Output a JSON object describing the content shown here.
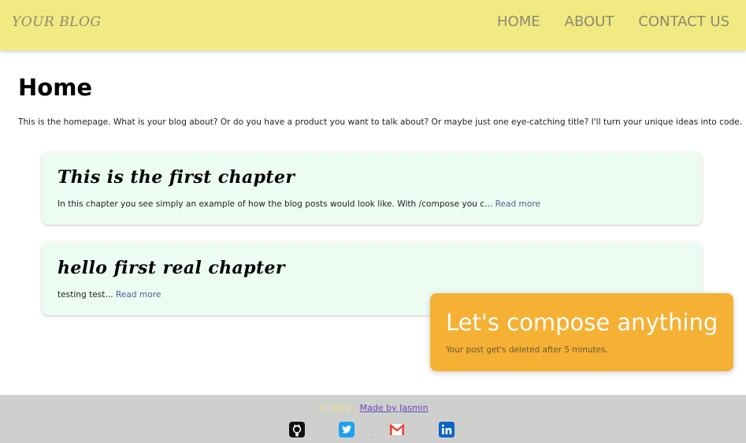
{
  "navbar": {
    "brand": "YOUR BLOG",
    "links": [
      "HOME",
      "ABOUT",
      "CONTACT US"
    ],
    "background": "#f1ea82"
  },
  "page": {
    "title": "Home",
    "intro": "This is the homepage. What is your blog about? Or do you have a product you want to talk about? Or maybe just one eye-catching title? I'll turn your unique ideas into code."
  },
  "posts": [
    {
      "title": "This is the first chapter",
      "excerpt": "In this chapter you see simply an example of how the blog posts would look like. With /compose you c...",
      "read_more": "Read more"
    },
    {
      "title": "hello first real chapter",
      "excerpt": "testing test...",
      "read_more": "Read more"
    }
  ],
  "compose": {
    "title": "Let's compose anything",
    "subtitle": "Your post get's deleted after 5 minutes.",
    "background": "#f4b134"
  },
  "footer": {
    "copyright": "© 2022",
    "separator": "|",
    "made_by": "Made by Jasmin",
    "social_icons": [
      "github-icon",
      "twitter-icon",
      "gmail-icon",
      "linkedin-icon"
    ]
  }
}
